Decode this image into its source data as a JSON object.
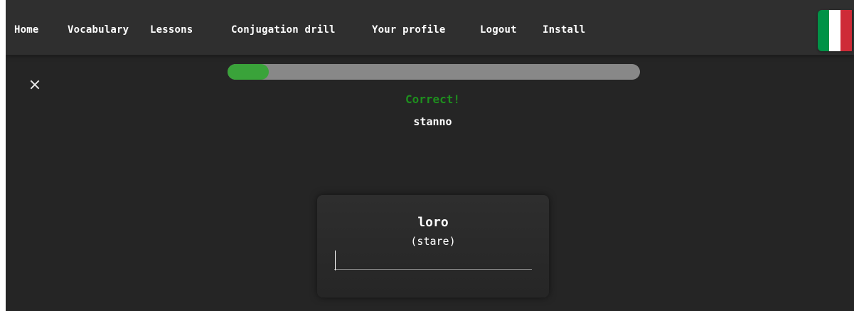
{
  "nav": {
    "items": [
      {
        "label": "Home"
      },
      {
        "label": "Vocabulary"
      },
      {
        "label": "Lessons"
      },
      {
        "label": "Conjugation drill"
      },
      {
        "label": "Your profile"
      },
      {
        "label": "Logout"
      },
      {
        "label": "Install"
      }
    ],
    "flag": {
      "icon": "italian-flag-icon",
      "colors": [
        "#009246",
        "#ffffff",
        "#ce2b37"
      ]
    }
  },
  "drill": {
    "close_icon": "close-icon",
    "progress_fraction": 0.1,
    "feedback": "Correct!",
    "correct_answer": "stanno",
    "pronoun": "loro",
    "verb": "(stare)",
    "input_value": ""
  },
  "colors": {
    "background": "#252525",
    "navbar": "#2f2f2f",
    "progress_track": "#888888",
    "progress_fill": "#3aa33a",
    "feedback_correct": "#1e8f1e"
  }
}
